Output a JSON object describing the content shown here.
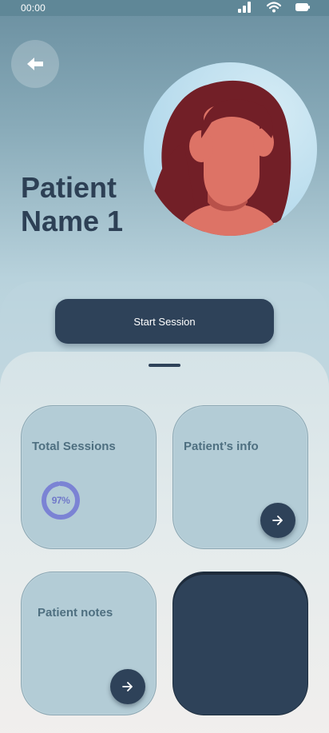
{
  "status_bar": {
    "time": "00:00",
    "icons": [
      "signal-icon",
      "wifi-icon",
      "battery-icon"
    ]
  },
  "header": {
    "back_icon": "arrow-left-icon",
    "patient_name": "Patient Name 1"
  },
  "actions": {
    "start_session_label": "Start Session"
  },
  "cards": {
    "total_sessions": {
      "title": "Total Sessions",
      "progress_label": "97%",
      "progress": 0.97
    },
    "patient_info": {
      "title": "Patient’s info",
      "icon": "arrow-right-icon"
    },
    "patient_notes": {
      "title": "Patient notes",
      "icon": "arrow-right-icon"
    }
  },
  "colors": {
    "primary_dark": "#2e4259",
    "card_bg": "#b3ccd6",
    "accent_progress": "#7b83d4",
    "title_text": "#2d4055"
  }
}
